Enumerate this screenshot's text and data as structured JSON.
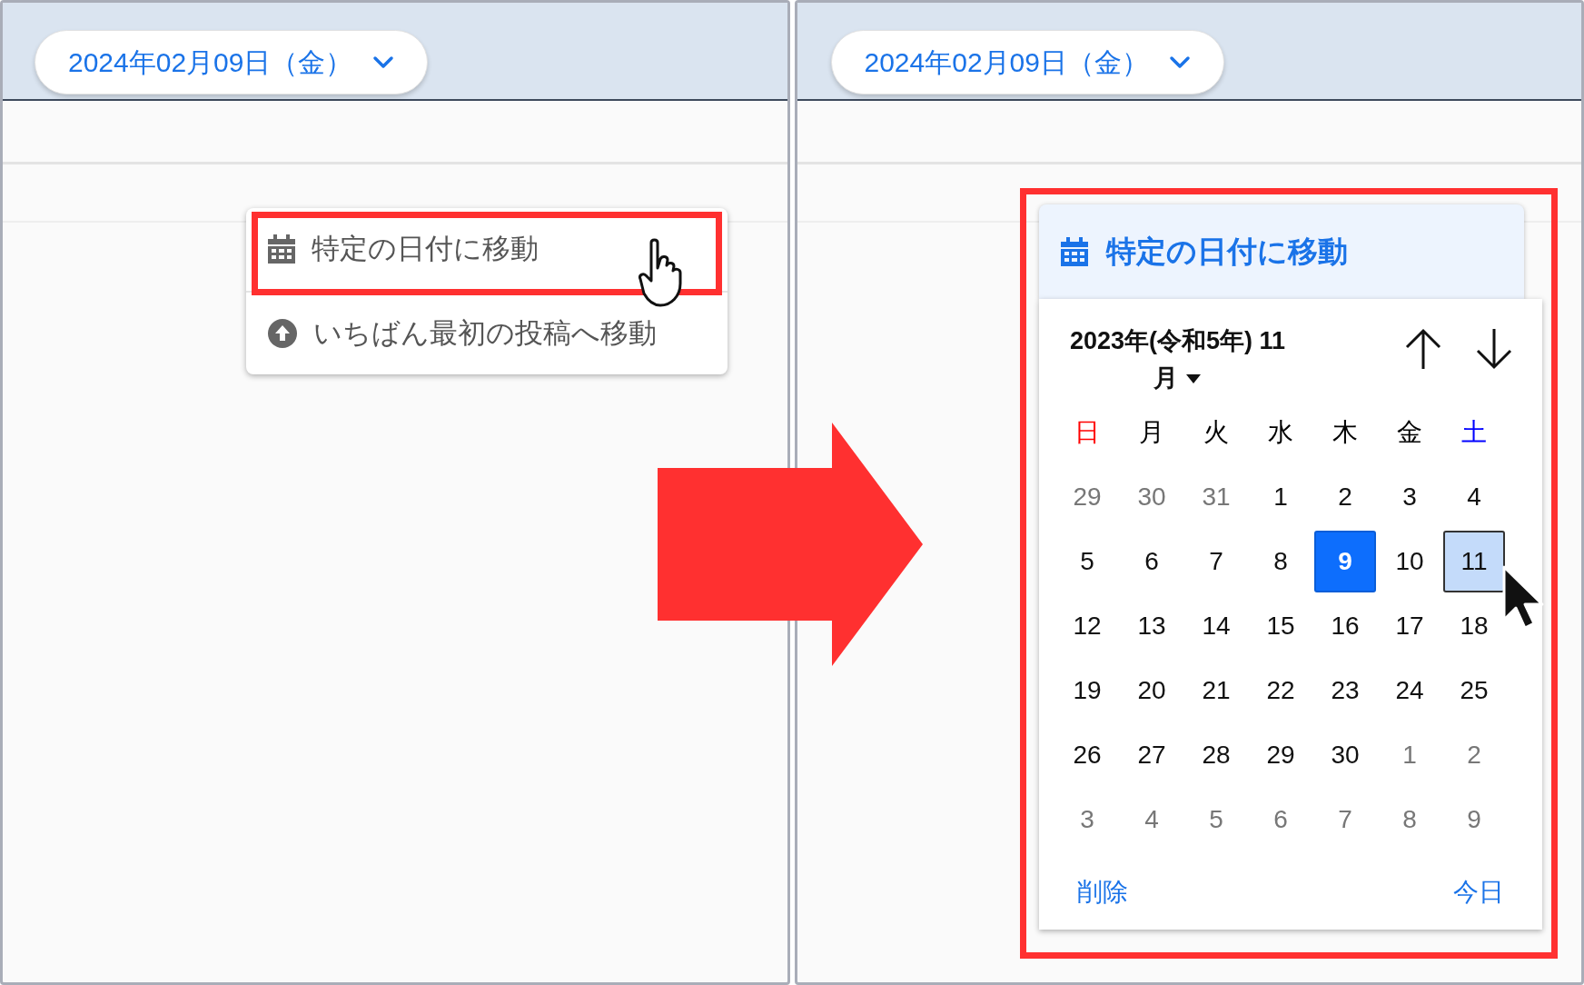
{
  "left_panel": {
    "date_button": {
      "label": "2024年02月09日（金）"
    },
    "menu": [
      {
        "kind": "calendar",
        "label": "特定の日付に移動",
        "highlighted": true
      },
      {
        "kind": "up",
        "label": "いちばん最初の投稿へ移動",
        "highlighted": false
      }
    ]
  },
  "right_panel": {
    "date_button": {
      "label": "2024年02月09日（金）"
    },
    "menu_item": {
      "kind": "calendar",
      "label": "特定の日付に移動"
    },
    "datepicker": {
      "month_label": "2023年(令和5年) 11 月",
      "weekdays": [
        {
          "label": "日",
          "color": "#ff0000"
        },
        {
          "label": "月",
          "color": "#000000"
        },
        {
          "label": "火",
          "color": "#000000"
        },
        {
          "label": "水",
          "color": "#000000"
        },
        {
          "label": "木",
          "color": "#000000"
        },
        {
          "label": "金",
          "color": "#000000"
        },
        {
          "label": "土",
          "color": "#0000ff"
        }
      ],
      "weeks": [
        [
          {
            "label": "29",
            "muted": true,
            "selected": false,
            "hovered": false
          },
          {
            "label": "30",
            "muted": true,
            "selected": false,
            "hovered": false
          },
          {
            "label": "31",
            "muted": true,
            "selected": false,
            "hovered": false
          },
          {
            "label": "1",
            "muted": false,
            "selected": false,
            "hovered": false
          },
          {
            "label": "2",
            "muted": false,
            "selected": false,
            "hovered": false
          },
          {
            "label": "3",
            "muted": false,
            "selected": false,
            "hovered": false
          },
          {
            "label": "4",
            "muted": false,
            "selected": false,
            "hovered": false
          }
        ],
        [
          {
            "label": "5",
            "muted": false,
            "selected": false,
            "hovered": false
          },
          {
            "label": "6",
            "muted": false,
            "selected": false,
            "hovered": false
          },
          {
            "label": "7",
            "muted": false,
            "selected": false,
            "hovered": false
          },
          {
            "label": "8",
            "muted": false,
            "selected": false,
            "hovered": false
          },
          {
            "label": "9",
            "muted": false,
            "selected": true,
            "hovered": false
          },
          {
            "label": "10",
            "muted": false,
            "selected": false,
            "hovered": false
          },
          {
            "label": "11",
            "muted": false,
            "selected": false,
            "hovered": true
          }
        ],
        [
          {
            "label": "12",
            "muted": false,
            "selected": false,
            "hovered": false
          },
          {
            "label": "13",
            "muted": false,
            "selected": false,
            "hovered": false
          },
          {
            "label": "14",
            "muted": false,
            "selected": false,
            "hovered": false
          },
          {
            "label": "15",
            "muted": false,
            "selected": false,
            "hovered": false
          },
          {
            "label": "16",
            "muted": false,
            "selected": false,
            "hovered": false
          },
          {
            "label": "17",
            "muted": false,
            "selected": false,
            "hovered": false
          },
          {
            "label": "18",
            "muted": false,
            "selected": false,
            "hovered": false
          }
        ],
        [
          {
            "label": "19",
            "muted": false,
            "selected": false,
            "hovered": false
          },
          {
            "label": "20",
            "muted": false,
            "selected": false,
            "hovered": false
          },
          {
            "label": "21",
            "muted": false,
            "selected": false,
            "hovered": false
          },
          {
            "label": "22",
            "muted": false,
            "selected": false,
            "hovered": false
          },
          {
            "label": "23",
            "muted": false,
            "selected": false,
            "hovered": false
          },
          {
            "label": "24",
            "muted": false,
            "selected": false,
            "hovered": false
          },
          {
            "label": "25",
            "muted": false,
            "selected": false,
            "hovered": false
          }
        ],
        [
          {
            "label": "26",
            "muted": false,
            "selected": false,
            "hovered": false
          },
          {
            "label": "27",
            "muted": false,
            "selected": false,
            "hovered": false
          },
          {
            "label": "28",
            "muted": false,
            "selected": false,
            "hovered": false
          },
          {
            "label": "29",
            "muted": false,
            "selected": false,
            "hovered": false
          },
          {
            "label": "30",
            "muted": false,
            "selected": false,
            "hovered": false
          },
          {
            "label": "1",
            "muted": true,
            "selected": false,
            "hovered": false
          },
          {
            "label": "2",
            "muted": true,
            "selected": false,
            "hovered": false
          }
        ],
        [
          {
            "label": "3",
            "muted": true,
            "selected": false,
            "hovered": false
          },
          {
            "label": "4",
            "muted": true,
            "selected": false,
            "hovered": false
          },
          {
            "label": "5",
            "muted": true,
            "selected": false,
            "hovered": false
          },
          {
            "label": "6",
            "muted": true,
            "selected": false,
            "hovered": false
          },
          {
            "label": "7",
            "muted": true,
            "selected": false,
            "hovered": false
          },
          {
            "label": "8",
            "muted": true,
            "selected": false,
            "hovered": false
          },
          {
            "label": "9",
            "muted": true,
            "selected": false,
            "hovered": false
          }
        ]
      ],
      "clear_link": "削除",
      "today_link": "今日"
    }
  }
}
